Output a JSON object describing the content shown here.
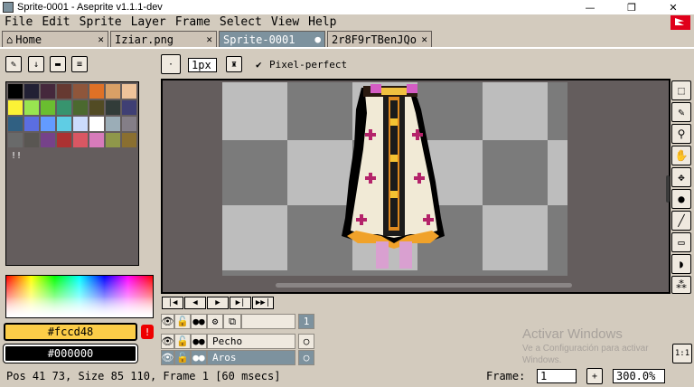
{
  "window": {
    "title": "Sprite-0001 - Aseprite v1.1.1-dev"
  },
  "menu": [
    {
      "label": "File"
    },
    {
      "label": "Edit"
    },
    {
      "label": "Sprite"
    },
    {
      "label": "Layer"
    },
    {
      "label": "Frame"
    },
    {
      "label": "Select"
    },
    {
      "label": "View"
    },
    {
      "label": "Help"
    }
  ],
  "tabs": [
    {
      "label": "Home",
      "close": "✕"
    },
    {
      "label": "Iziar.png",
      "close": "✕"
    },
    {
      "label": "Sprite-0001",
      "close": "●"
    },
    {
      "label": "2r8F9rTBenJQo",
      "close": "✕"
    }
  ],
  "toolbar": {
    "brush_size": "1px",
    "pixel_perfect_label": "Pixel-perfect",
    "pixel_perfect_checked": "✔"
  },
  "palette": {
    "colors": [
      "#000000",
      "#222034",
      "#45283c",
      "#663931",
      "#8f563b",
      "#df7126",
      "#d9a066",
      "#eec39a",
      "#fbf236",
      "#99e550",
      "#6abe30",
      "#37946e",
      "#4b692f",
      "#524b24",
      "#323c39",
      "#3f3f74",
      "#306082",
      "#5b6ee1",
      "#639bff",
      "#5fcde4",
      "#cbdbfc",
      "#ffffff",
      "#9badb7",
      "#847e87",
      "#696a6a",
      "#595652",
      "#76428a",
      "#ac3232",
      "#d95763",
      "#d77bba",
      "#8f974a",
      "#8a6f30"
    ],
    "mode_label": "!!"
  },
  "colors": {
    "foreground": {
      "hex": "#fccd48",
      "label": "#fccd48"
    },
    "background": {
      "hex": "#000000",
      "label": "#000000"
    },
    "warning": "!"
  },
  "animation": {
    "controls": [
      "|◀",
      "◀",
      "▶",
      "▶|",
      "▶▶|"
    ]
  },
  "timeline": {
    "frame_number": "1",
    "layers": [
      {
        "name": "",
        "visible": "👁",
        "lock": "🔓",
        "continuous": "●●",
        "cel": ""
      },
      {
        "name": "Pecho",
        "visible": "👁",
        "lock": "🔓",
        "continuous": "●●",
        "cel": "○"
      },
      {
        "name": "Aros",
        "visible": "👁",
        "lock": "🔓",
        "continuous": "●●",
        "cel": "○"
      }
    ]
  },
  "watermark": {
    "line1": "Activar Windows",
    "line2": "Ve a Configuración para activar",
    "line3": "Windows."
  },
  "status": {
    "info": "Pos 41 73, Size 85 110, Frame 1 [60 msecs]",
    "frame_label": "Frame:",
    "frame_value": "1",
    "add_frame": "+",
    "zoom": "300.0%"
  },
  "buttons": {
    "onion": "1:1"
  }
}
